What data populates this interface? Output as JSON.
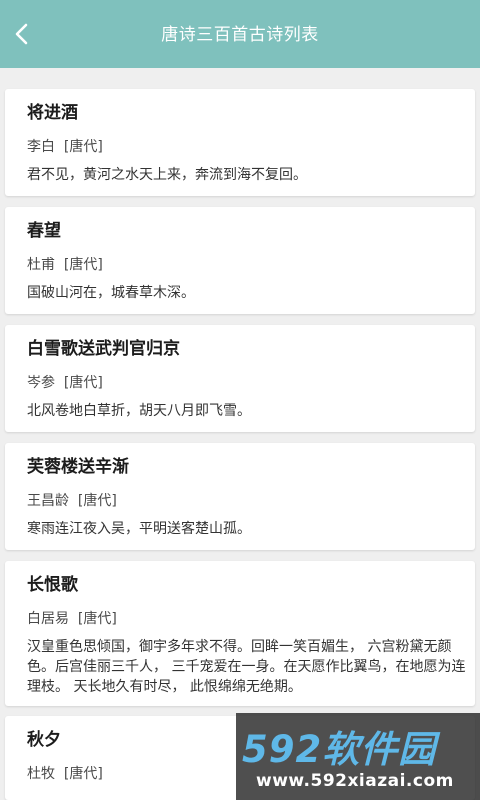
{
  "header": {
    "title": "唐诗三百首古诗列表",
    "back_icon": "back-arrow-icon",
    "background_color": "#7fc1bd"
  },
  "poems": [
    {
      "title": "将进酒",
      "author": "李白  [唐代]",
      "text": "君不见，黄河之水天上来，奔流到海不复回。"
    },
    {
      "title": "春望",
      "author": "杜甫  [唐代]",
      "text": "国破山河在，城春草木深。"
    },
    {
      "title": "白雪歌送武判官归京",
      "author": "岑参  [唐代]",
      "text": "北风卷地白草折，胡天八月即飞雪。"
    },
    {
      "title": "芙蓉楼送辛渐",
      "author": "王昌龄  [唐代]",
      "text": "寒雨连江夜入吴，平明送客楚山孤。"
    },
    {
      "title": "长恨歌",
      "author": "白居易  [唐代]",
      "text": "汉皇重色思倾国，御宇多年求不得。回眸一笑百媚生， 六宫粉黛无颜色。后宫佳丽三千人， 三千宠爱在一身。在天愿作比翼鸟，在地愿为连理枝。 天长地久有时尽， 此恨绵绵无绝期。"
    },
    {
      "title": "秋夕",
      "author": "杜牧  [唐代]",
      "text": ""
    }
  ],
  "watermark": {
    "brand": "592软件园",
    "url": "www.592xiazai.com"
  }
}
